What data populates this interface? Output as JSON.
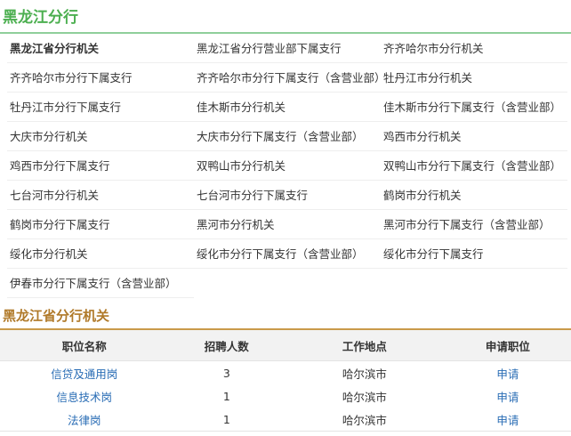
{
  "section": {
    "title": "黑龙江分行"
  },
  "branches": [
    [
      "黑龙江省分行机关",
      "黑龙江省分行营业部下属支行",
      "齐齐哈尔市分行机关"
    ],
    [
      "齐齐哈尔市分行下属支行",
      "齐齐哈尔市分行下属支行（含营业部）",
      "牡丹江市分行机关"
    ],
    [
      "牡丹江市分行下属支行",
      "佳木斯市分行机关",
      "佳木斯市分行下属支行（含营业部）"
    ],
    [
      "大庆市分行机关",
      "大庆市分行下属支行（含营业部）",
      "鸡西市分行机关"
    ],
    [
      "鸡西市分行下属支行",
      "双鸭山市分行机关",
      "双鸭山市分行下属支行（含营业部）"
    ],
    [
      "七台河市分行机关",
      "七台河市分行下属支行",
      "鹤岗市分行机关"
    ],
    [
      "鹤岗市分行下属支行",
      "黑河市分行机关",
      "黑河市分行下属支行（含营业部）"
    ],
    [
      "绥化市分行机关",
      "绥化市分行下属支行（含营业部）",
      "绥化市分行下属支行"
    ],
    [
      "伊春市分行下属支行（含营业部）"
    ]
  ],
  "jobs_section": {
    "title": "黑龙江省分行机关"
  },
  "table": {
    "headers": [
      "职位名称",
      "招聘人数",
      "工作地点",
      "申请职位"
    ],
    "rows": [
      {
        "name": "信贷及通用岗",
        "count": "3",
        "location": "哈尔滨市",
        "action": "申请"
      },
      {
        "name": "信息技术岗",
        "count": "1",
        "location": "哈尔滨市",
        "action": "申请"
      },
      {
        "name": "法律岗",
        "count": "1",
        "location": "哈尔滨市",
        "action": "申请"
      }
    ]
  },
  "colors": {
    "section_green": "#4caf50",
    "subtitle_brown": "#b07a2a",
    "link_blue": "#2a6db5"
  }
}
